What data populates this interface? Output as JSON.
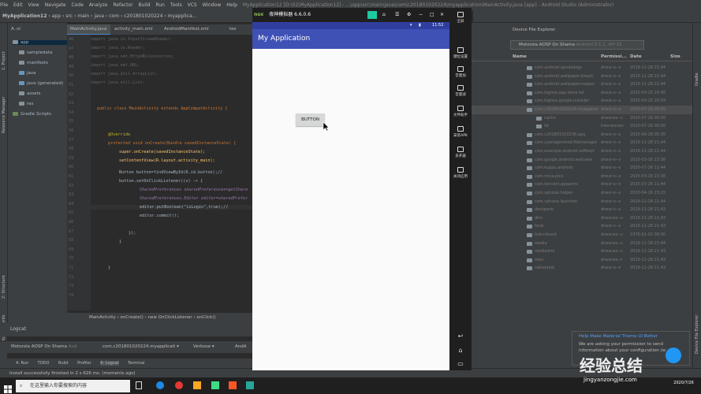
{
  "menubar": {
    "items": [
      "File",
      "Edit",
      "View",
      "Navigate",
      "Code",
      "Analyze",
      "Refactor",
      "Build",
      "Run",
      "Tools",
      "VCS",
      "Window",
      "Help"
    ],
    "title": "MyApplication12 [D:\\02\\MyApplication12] - ...\\app\\src\\main\\java\\com\\c201801020224\\myapplication\\MainActivity.java [app] - Android Studio (Administrator)"
  },
  "nav": {
    "items": [
      "MyApplication12",
      "app",
      "src",
      "main",
      "java",
      "com",
      "c201801020224",
      "myapplica..."
    ]
  },
  "editor_tabs": [
    "MainActivity.java",
    "activity_main.xml",
    "AndroidManifest.xml",
    "tes"
  ],
  "project_tree": {
    "header": "A..vi",
    "items": [
      "app",
      "sampledata",
      "manifests",
      "java",
      "java (generated)",
      "assets",
      "res",
      "Gradle Scripts"
    ]
  },
  "code_lines": [
    {
      "n": "",
      "text": "import java.io.InputStreamReader;"
    },
    {
      "n": "",
      "text": "import java.io.Reader;"
    },
    {
      "n": "",
      "text": "import java.net.HttpURLConnection;"
    },
    {
      "n": "",
      "text": "import java.net.URL;"
    },
    {
      "n": "",
      "text": "import java.util.ArrayList;"
    },
    {
      "n": "",
      "text": "import java.util.List;"
    },
    {
      "n": "",
      "text": "public class MainActivity extends AppCompatActivity {"
    },
    {
      "n": "",
      "text": "@Override"
    },
    {
      "n": "",
      "text": "protected void onCreate(Bundle savedInstanceState) {"
    },
    {
      "n": "",
      "text": "super.onCreate(savedInstanceState);"
    },
    {
      "n": "",
      "text": "setContentView(R.layout.activity_main);"
    },
    {
      "n": "",
      "text": "Button button=findViewById(R.id.button);//"
    },
    {
      "n": "",
      "text": "button.setOnClickListener((v) -> {"
    },
    {
      "n": "",
      "text": "SharedPreferences sharedPreferences=getShare"
    },
    {
      "n": "",
      "text": "SharedPreferences.Editor editor=sharedPrefer"
    },
    {
      "n": "",
      "text": "editor.putBoolean(\"isLogin\",true);//"
    },
    {
      "n": "",
      "text": "editor.commit();"
    },
    {
      "n": "",
      "text": "});"
    },
    {
      "n": "",
      "text": "}"
    },
    {
      "n": "",
      "text": "}"
    }
  ],
  "line_numbers": [
    "46",
    "47",
    "48",
    "49",
    "50",
    "51",
    "52",
    "53",
    "54",
    "55",
    "56",
    "57",
    "58",
    "59",
    "60",
    "61",
    "62",
    "63",
    "64",
    "65",
    "66",
    "67",
    "68",
    "69",
    "70",
    "71",
    "72",
    "73",
    "74"
  ],
  "breadcrumb": [
    "MainActivity",
    "onCreate()",
    "new OnClickListener",
    "onClick()"
  ],
  "logcat": {
    "title": "Logcat",
    "device": "Motorola AOSP On Shama",
    "device_suffix": "And",
    "process": "com.c201801020224.myapplicati",
    "level": "Verbose",
    "extra": "AndA"
  },
  "bottom_tools": [
    "4: Run",
    "TODO",
    "Build",
    "Profiler",
    "6: Logcat",
    "Terminal"
  ],
  "status": "Install successfully finished in 2 s 626 ms. (moments ago)",
  "emulator": {
    "brand": "nox",
    "title": "夜神模拟器 6.6.0.6",
    "time": "11:52",
    "app_title": "My Application",
    "button": "BUTTON",
    "side": [
      "全屏",
      "键位设置",
      "音量加",
      "音量减",
      "文件助手",
      "安装APK",
      "多开器",
      "关闭应用"
    ]
  },
  "dfe": {
    "title": "Device File Explorer",
    "device": "Motorola AOSP On Shama",
    "device_suffix": "Android 5.1.1, API 22",
    "columns": [
      "Name",
      "Permissi...",
      "Date",
      "Size"
    ],
    "rows": [
      {
        "name": "com.android.opndialogs",
        "perm": "drwxr-x--x",
        "date": "2019-11-28 21:44"
      },
      {
        "name": "com.android.wallpaper.liveplc",
        "perm": "drwxr-x--x",
        "date": "2019-11-28 21:44"
      },
      {
        "name": "com.android.wallpapercropper",
        "perm": "drwxr-x--x",
        "date": "2019-11-28 21:44"
      },
      {
        "name": "com.bignox.app.store.hd",
        "perm": "drwxr-x--x",
        "date": "2020-03-25 16:45"
      },
      {
        "name": "com.bignox.google.installer",
        "perm": "drwxr-x--x",
        "date": "2020-03-25 16:59"
      },
      {
        "name": "com.c201801020224.myapplicatio",
        "perm": "drwxr-x--x",
        "date": "2020-07-26 00:05",
        "sel": true
      },
      {
        "name": "cache",
        "perm": "drwxrwx--x",
        "date": "2020-07-26 00:05"
      },
      {
        "name": "lib",
        "perm": "lrwxrwxrwx",
        "date": "2020-07-26 00:05"
      },
      {
        "name": "com.c201801020236.qyq",
        "perm": "drwxr-x--x",
        "date": "2020-06-28 00:35"
      },
      {
        "name": "com.cyanogenmod.filemanager",
        "perm": "drwxr-x--x",
        "date": "2019-11-28 21:44"
      },
      {
        "name": "com.example.android.softkeyt",
        "perm": "drwxr-x--x",
        "date": "2019-11-28 21:44"
      },
      {
        "name": "com.google.android.webview",
        "perm": "drwxr-x--x",
        "date": "2020-03-16 23:38"
      },
      {
        "name": "com.kugou.android",
        "perm": "drwxr-x--x",
        "date": "2020-07-26 11:44"
      },
      {
        "name": "com.nova.pico",
        "perm": "drwxr-x--x",
        "date": "2020-03-16 23:38"
      },
      {
        "name": "com.tencent.qqsports",
        "perm": "drwxr-x--x",
        "date": "2020-07-26 11:44"
      },
      {
        "name": "com.vphone.helper",
        "perm": "drwxr-x--x",
        "date": "2020-04-26 23:15"
      },
      {
        "name": "com.vphone.launcher",
        "perm": "drwxr-x--x",
        "date": "2019-11-28 21:44"
      },
      {
        "name": "dontpanic",
        "perm": "drwxr-x--x",
        "date": "2019-11-28 21:43"
      },
      {
        "name": "drm",
        "perm": "drwxrwx--x",
        "date": "2019-11-28 21:43"
      },
      {
        "name": "local",
        "perm": "drwxr-x--x",
        "date": "2019-11-28 21:43"
      },
      {
        "name": "lost+found",
        "perm": "drwxrwx--x",
        "date": "1970-01-01 08:00"
      },
      {
        "name": "media",
        "perm": "drwxrwx--x",
        "date": "2019-11-28 21:44"
      },
      {
        "name": "mediadrm",
        "perm": "drwxrwx--x",
        "date": "2019-11-28 21:43"
      },
      {
        "name": "misc",
        "perm": "drwxrwx--t",
        "date": "2019-11-28 21:43"
      },
      {
        "name": "nativetest",
        "perm": "drwxr-x--x",
        "date": "2019-11-28 21:43"
      }
    ]
  },
  "notification": {
    "title": "Help Make Material Theme UI Better",
    "body": "We are asking your permission to send information about your configuration (w"
  },
  "taskbar": {
    "search": "在这里输入你要搜索的内容"
  },
  "clock": {
    "date": "2020/7/26"
  },
  "watermark": {
    "big": "经验总结",
    "sub": "jingyanzongjie.com"
  }
}
